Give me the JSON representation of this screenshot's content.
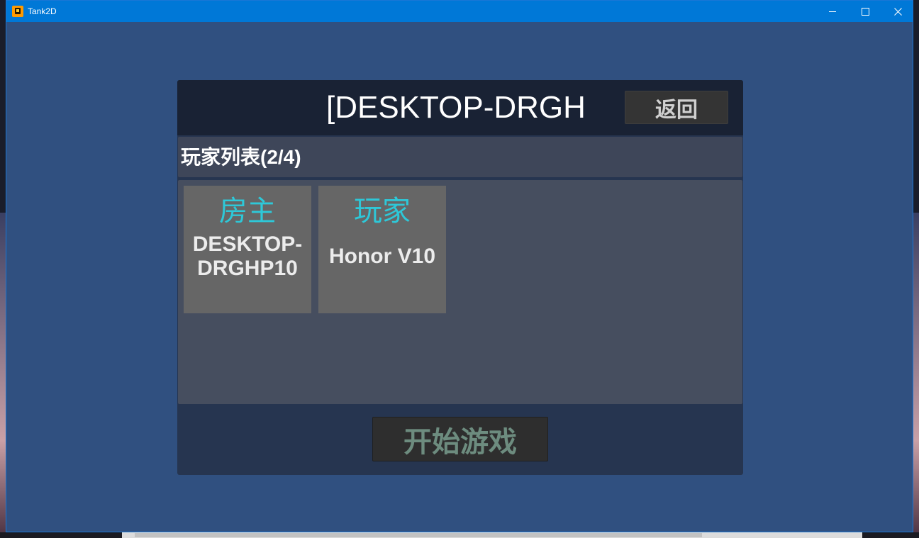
{
  "window": {
    "title": "Tank2D",
    "controls": {
      "minimize": "minimize-icon",
      "maximize": "maximize-icon",
      "close": "close-icon"
    }
  },
  "room": {
    "title": "[DESKTOP-DRGH",
    "back_label": "返回"
  },
  "player_list": {
    "title": "玩家列表(2/4)",
    "players": [
      {
        "role": "房主",
        "name": "DESKTOP-DRGHP10"
      },
      {
        "role": "玩家",
        "name": "Honor V10"
      }
    ]
  },
  "start_label": "开始游戏",
  "colors": {
    "background": "#305080",
    "titlebar": "#0078d7",
    "role_text": "#2ec8d8",
    "card": "#666666",
    "start_text": "#6d8c7f"
  }
}
